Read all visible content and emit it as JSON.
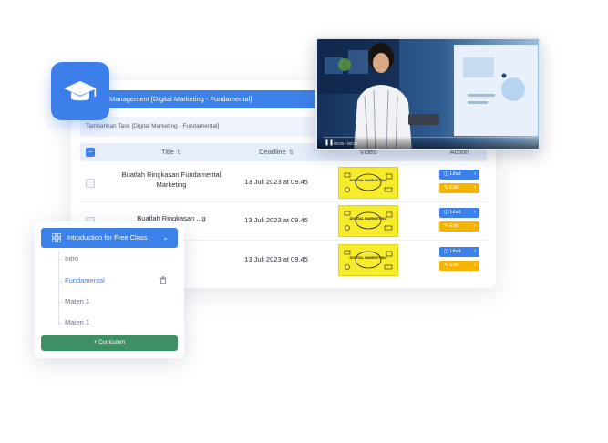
{
  "task_panel": {
    "management_title": "Management [Digital Marketing - Fundamental]",
    "add_task_title": "Tambahkan Task [Digital Marketing - Fundamental]",
    "columns": {
      "title": "Title",
      "deadline": "Deadline",
      "video": "Video",
      "action": "Action"
    },
    "rows": [
      {
        "title": "Buatlah Ringkasan Fundamental Marketing",
        "deadline": "13 Juli 2023 at 09.45",
        "thumbnail_text": "DIGITAL MARKETING",
        "view_label": "Lihat",
        "edit_label": "Edit"
      },
      {
        "title": "Buatlah Ringkasan ...g",
        "deadline": "13 Juli 2023 at 09.45",
        "thumbnail_text": "DIGITAL MARKETING",
        "view_label": "Lihat",
        "edit_label": "Edit"
      },
      {
        "title": "...g",
        "deadline": "13 Juli 2023 at 09.45",
        "thumbnail_text": "DIGITAL MARKETING",
        "view_label": "Lihat",
        "edit_label": "Edit"
      }
    ]
  },
  "video_player": {
    "time": "00:00 / 00:35",
    "progress": 0
  },
  "curriculum": {
    "header": "Introduction for Free Class",
    "items": [
      "Intro",
      "Fundamental",
      "Materi 1",
      "Materi 1"
    ],
    "active_item": "Fundamental",
    "add_button": "+ Curriculum"
  },
  "colors": {
    "primary": "#3d82ea",
    "warning": "#f5b400",
    "success": "#3e8f63",
    "thumbnail": "#f7ec2b"
  },
  "icons": [
    "graduation-cap-icon",
    "grid-icon",
    "chevron-down-icon",
    "trash-icon",
    "sort-icon",
    "eye-icon",
    "edit-icon",
    "play-icon"
  ]
}
